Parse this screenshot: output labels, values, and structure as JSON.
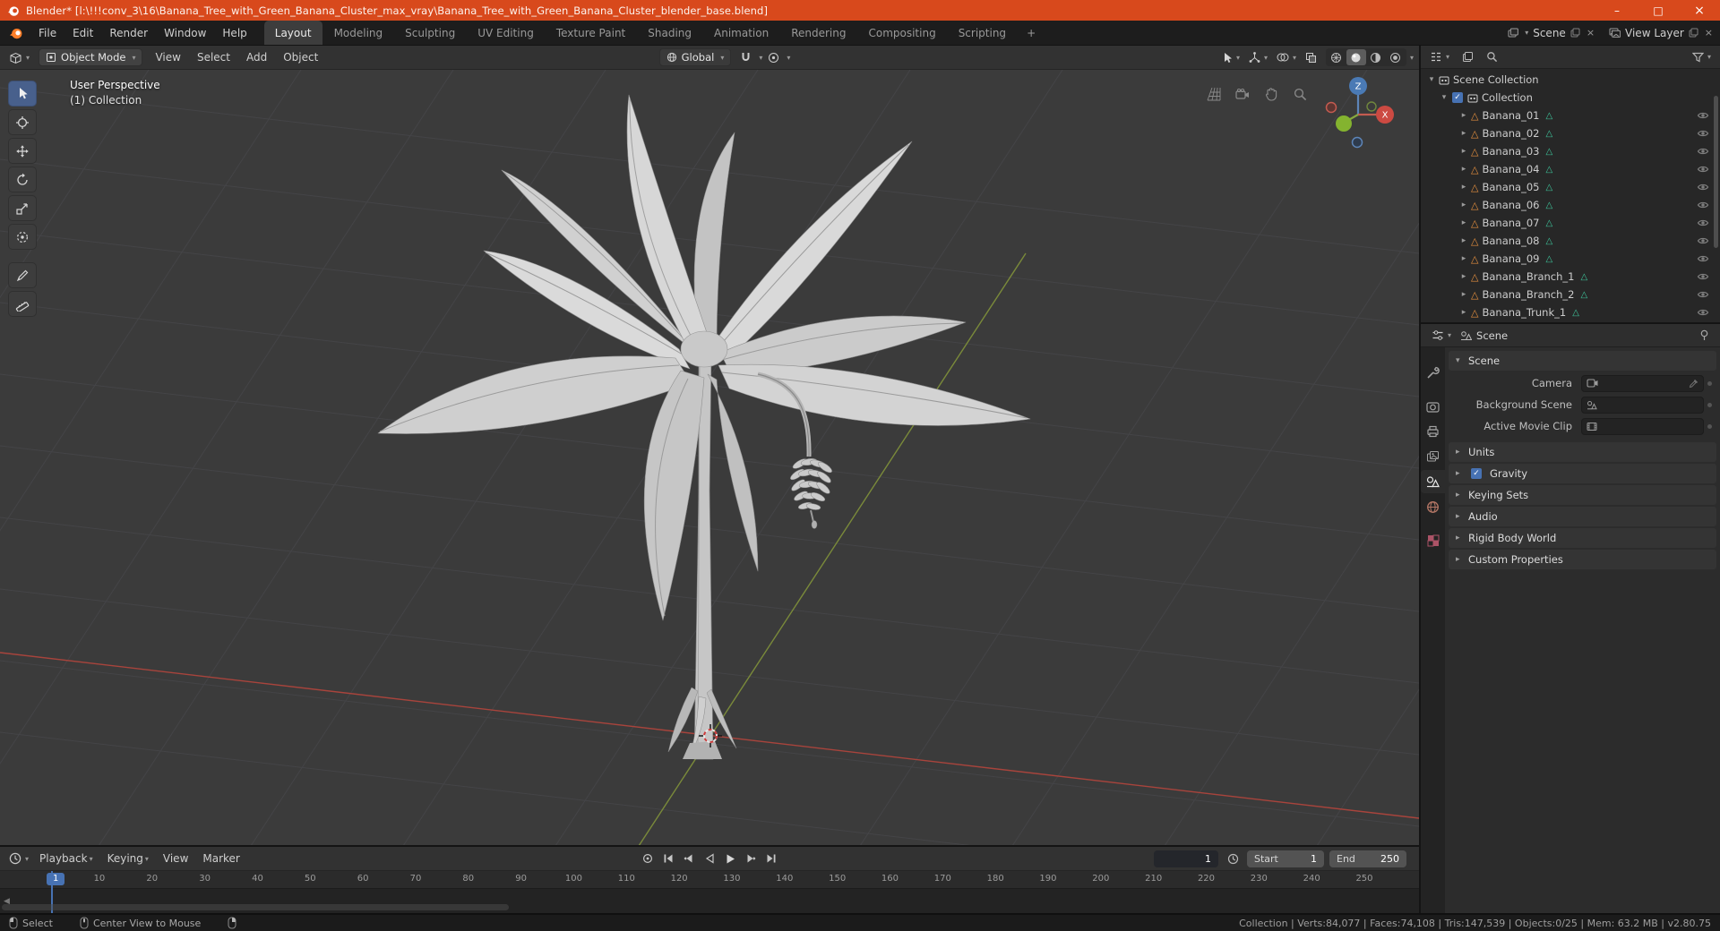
{
  "window": {
    "title": "Blender* [l:\\!!!conv_3\\16\\Banana_Tree_with_Green_Banana_Cluster_max_vray\\Banana_Tree_with_Green_Banana_Cluster_blender_base.blend]",
    "controls": {
      "minimize": "–",
      "maximize": "□",
      "close": "×"
    }
  },
  "topbar": {
    "menus": [
      "File",
      "Edit",
      "Render",
      "Window",
      "Help"
    ],
    "workspaces": [
      "Layout",
      "Modeling",
      "Sculpting",
      "UV Editing",
      "Texture Paint",
      "Shading",
      "Animation",
      "Rendering",
      "Compositing",
      "Scripting"
    ],
    "active_workspace": "Layout",
    "add_workspace": "+",
    "scene": "Scene",
    "view_layer": "View Layer"
  },
  "viewport": {
    "mode": "Object Mode",
    "menus": [
      "View",
      "Select",
      "Add",
      "Object"
    ],
    "orientation": "Global",
    "overlay_line1": "User Perspective",
    "overlay_line2": "(1) Collection",
    "axis_z": "Z",
    "axis_x": "X"
  },
  "outliner": {
    "scene_collection": "Scene Collection",
    "collection": "Collection",
    "items": [
      "Banana_01",
      "Banana_02",
      "Banana_03",
      "Banana_04",
      "Banana_05",
      "Banana_06",
      "Banana_07",
      "Banana_08",
      "Banana_09",
      "Banana_Branch_1",
      "Banana_Branch_2",
      "Banana_Trunk_1"
    ]
  },
  "properties": {
    "breadcrumb": "Scene",
    "scene_panel_title": "Scene",
    "camera_label": "Camera",
    "background_scene_label": "Background Scene",
    "active_movie_clip_label": "Active Movie Clip",
    "panels": [
      "Units",
      "Gravity",
      "Keying Sets",
      "Audio",
      "Rigid Body World",
      "Custom Properties"
    ]
  },
  "timeline": {
    "menus": [
      "Playback",
      "Keying",
      "View",
      "Marker"
    ],
    "current_frame": "1",
    "start_label": "Start",
    "start_value": "1",
    "end_label": "End",
    "end_value": "250",
    "ruler": [
      "1",
      "10",
      "20",
      "30",
      "40",
      "50",
      "60",
      "70",
      "80",
      "90",
      "100",
      "110",
      "120",
      "130",
      "140",
      "150",
      "160",
      "170",
      "180",
      "190",
      "200",
      "210",
      "220",
      "230",
      "240",
      "250"
    ]
  },
  "statusbar": {
    "hint_select": "Select",
    "hint_center": "Center View to Mouse",
    "stats": "Collection | Verts:84,077 | Faces:74,108 | Tris:147,539 | Objects:0/25 | Mem: 63.2 MB | v2.80.75"
  },
  "icons": {
    "expand": "▸",
    "collapse": "▾",
    "dropdown": "▾",
    "mesh_object": "△",
    "check": "✓"
  },
  "colors": {
    "titlebar_orange": "#d8491c",
    "accent_blue": "#4772b3",
    "mesh_orange": "#e8913f",
    "data_teal": "#3ec59b",
    "axis_x_red": "#a8443c",
    "axis_y_green": "#7a8a3a"
  }
}
